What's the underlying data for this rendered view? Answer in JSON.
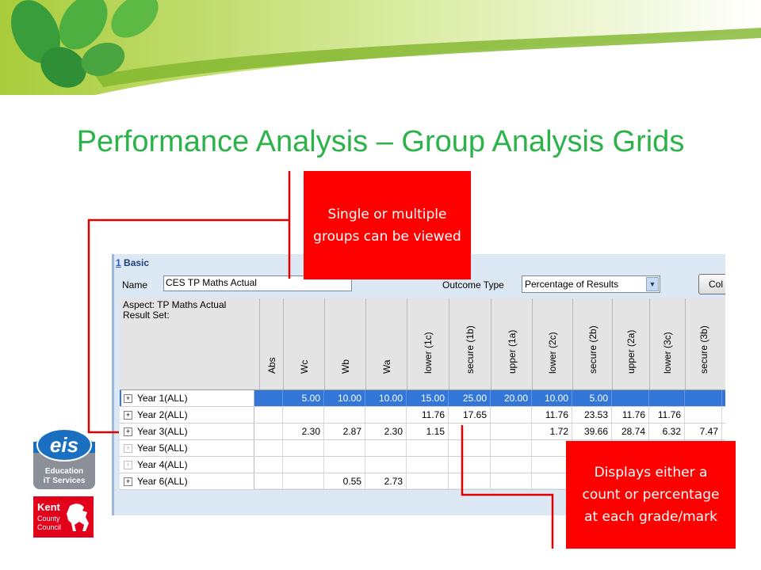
{
  "slide": {
    "title": "Performance Analysis – Group Analysis Grids",
    "callout_top": "Single or multiple groups can be viewed",
    "callout_bottom": "Displays either a count or percentage at each grade/mark"
  },
  "app": {
    "section": {
      "number": "1",
      "title": "Basic"
    },
    "name_label": "Name",
    "name_value": "CES TP Maths Actual",
    "outcome_type_label": "Outcome Type",
    "outcome_type_value": "Percentage of Results",
    "col_button": "Col",
    "grid": {
      "aspect_line1": "Aspect: TP Maths Actual",
      "aspect_line2": "Result Set:",
      "columns": [
        "Abs",
        "Wc",
        "Wb",
        "Wa",
        "lower (1c)",
        "secure (1b)",
        "upper (1a)",
        "lower (2c)",
        "secure (2b)",
        "upper (2a)",
        "lower (3c)",
        "secure (3b)"
      ],
      "rows": [
        {
          "group": "Year  1(ALL)",
          "expand": "+",
          "selected": true,
          "values": [
            "",
            "5.00",
            "10.00",
            "10.00",
            "15.00",
            "25.00",
            "20.00",
            "10.00",
            "5.00",
            "",
            "",
            ""
          ]
        },
        {
          "group": "Year  2(ALL)",
          "expand": "+",
          "selected": false,
          "values": [
            "",
            "",
            "",
            "",
            "11.76",
            "17.65",
            "",
            "11.76",
            "23.53",
            "11.76",
            "11.76",
            ""
          ]
        },
        {
          "group": "Year  3(ALL)",
          "expand": "+",
          "selected": false,
          "values": [
            "",
            "2.30",
            "2.87",
            "2.30",
            "1.15",
            "",
            "",
            "1.72",
            "39.66",
            "28.74",
            "6.32",
            "7.47"
          ]
        },
        {
          "group": "Year  5(ALL)",
          "expand": "+",
          "selected": false,
          "empty": true,
          "values": [
            "",
            "",
            "",
            "",
            "",
            "",
            "",
            "",
            "",
            "",
            "",
            ""
          ]
        },
        {
          "group": "Year  4(ALL)",
          "expand": "+",
          "selected": false,
          "empty": true,
          "values": [
            "",
            "",
            "",
            "",
            "",
            "",
            "",
            "",
            "",
            "",
            "",
            ""
          ]
        },
        {
          "group": "Year  6(ALL)",
          "expand": "+",
          "selected": false,
          "values": [
            "",
            "",
            "0.55",
            "2.73",
            "",
            "",
            "",
            "",
            "",
            "",
            "",
            ""
          ]
        }
      ]
    }
  },
  "logos": {
    "eis_text": "eis",
    "eis_line1": "Education",
    "eis_line2": "iT Services",
    "kent_line1": "Kent",
    "kent_line2": "County",
    "kent_line3": "Council"
  },
  "colors": {
    "title_green": "#2bb34a",
    "callout_red": "#ff0000",
    "selection_blue": "#3277d8"
  }
}
